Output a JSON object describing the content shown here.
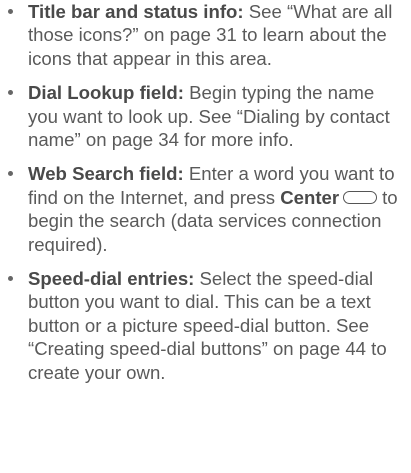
{
  "items": [
    {
      "term": "Title bar and status info:",
      "text": "See “What are all those icons?” on page 31 to learn about the icons that appear in this area."
    },
    {
      "term": "Dial Lookup field:",
      "text": "Begin typing the name you want to look up. See “Dialing by contact name” on page 34 for more info."
    },
    {
      "term": "Web Search field:",
      "text_before": "Enter a word you want to find on the Internet, and press",
      "key_label": "Center",
      "key_icon": "center-button-icon",
      "text_after": "to begin the search (data services connection required)."
    },
    {
      "term": "Speed-dial entries:",
      "text": "Select the speed-dial button you want to dial. This can be a text button or a picture speed-dial button. See “Creating speed-dial buttons” on page 44 to create your own."
    }
  ]
}
